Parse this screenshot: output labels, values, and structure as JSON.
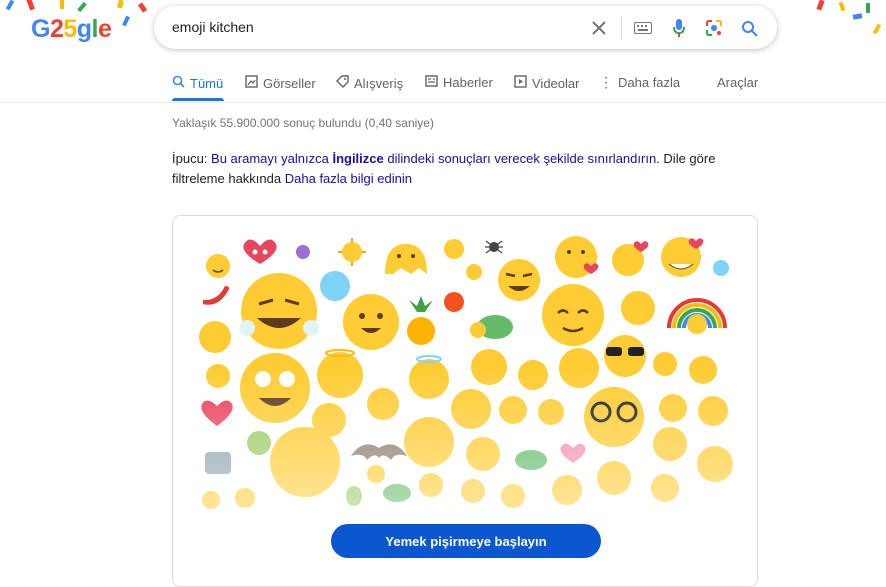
{
  "logo": {
    "letters": [
      "G",
      "2",
      "5",
      "g",
      "l",
      "e"
    ]
  },
  "search": {
    "query": "emoji kitchen"
  },
  "tabs": [
    {
      "label": "Tümü",
      "icon": "search-icon"
    },
    {
      "label": "Görseller",
      "icon": "image-icon"
    },
    {
      "label": "Alışveriş",
      "icon": "tag-icon"
    },
    {
      "label": "Haberler",
      "icon": "news-icon"
    },
    {
      "label": "Videolar",
      "icon": "play-icon"
    },
    {
      "label": "Daha fazla",
      "icon": "more-vert-icon"
    }
  ],
  "tools_label": "Araçlar",
  "result_stats": "Yaklaşık 55.900.000 sonuç bulundu (0,40 saniye)",
  "tip": {
    "prefix": "İpucu:",
    "part1": "Bu aramayı yalnızca",
    "language": "İngilizce",
    "part2": "dilindeki sonuçları verecek şekilde sınırlandırın.",
    "part3": "Dile göre filtreleme hakkında",
    "learn_more": "Daha fazla bilgi edinin"
  },
  "emoji_kitchen": {
    "cta_label": "Yemek pişirmeye başlayın"
  },
  "colors": {
    "accent": "#1a73e8",
    "link": "#1a0dab",
    "cta": "#0b57d0",
    "emoji_yellow": "#ffcc33"
  }
}
